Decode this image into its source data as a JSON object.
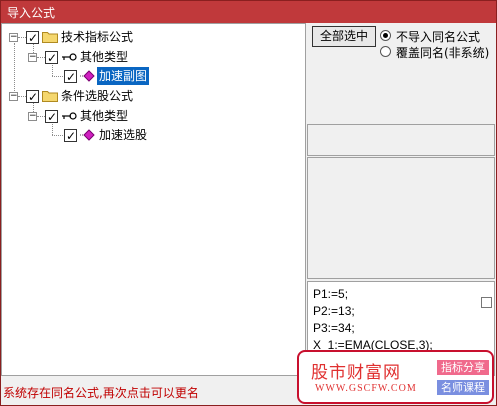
{
  "window": {
    "title": "导入公式"
  },
  "tree": {
    "root1": {
      "label": "技术指标公式",
      "expander": "−",
      "checked": true
    },
    "root1_child": {
      "label": "其他类型",
      "expander": "−",
      "checked": true
    },
    "root1_leaf": {
      "label": "加速副图",
      "checked": true,
      "selected": true
    },
    "root2": {
      "label": "条件选股公式",
      "expander": "−",
      "checked": true
    },
    "root2_child": {
      "label": "其他类型",
      "expander": "−",
      "checked": true
    },
    "root2_leaf": {
      "label": "加速选股",
      "checked": true
    }
  },
  "controls": {
    "select_all_label": "全部选中",
    "radio_options": [
      {
        "label": "不导入同名公式",
        "selected": true
      },
      {
        "label": "覆盖同名(非系统)",
        "selected": false
      }
    ]
  },
  "formula": {
    "lines": [
      "P1:=5;",
      "P2:=13;",
      "P3:=34;",
      "X_1:=EMA(CLOSE,3);"
    ]
  },
  "status": {
    "message": "系统存在同名公式,再次点击可以更名"
  },
  "watermark": {
    "title": "股市财富网",
    "url": "WWW.GSCFW.COM",
    "tag1": "指标分享",
    "tag2": "名师课程"
  },
  "colors": {
    "titlebar": "#c0393b",
    "selection": "#0a66c2",
    "status_text": "#c00000",
    "watermark_red": "#e03030"
  }
}
